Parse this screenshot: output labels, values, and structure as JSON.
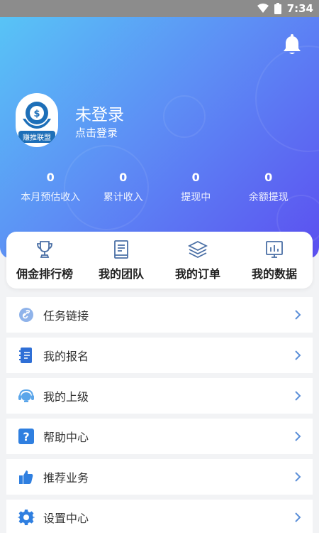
{
  "status_bar": {
    "time": "7:34",
    "wifi_icon": "wifi-icon",
    "battery_icon": "battery-icon"
  },
  "header": {
    "notification_icon": "bell-icon",
    "avatar_logo_text": "赚推联盟",
    "user_name": "未登录",
    "login_hint": "点击登录",
    "colors": {
      "gradient_start": "#58c4f6",
      "gradient_mid": "#5d8ff5",
      "gradient_end": "#5b4ff0"
    }
  },
  "stats": [
    {
      "value": "0",
      "label": "本月预估收入"
    },
    {
      "value": "0",
      "label": "累计收入"
    },
    {
      "value": "0",
      "label": "提现中"
    },
    {
      "value": "0",
      "label": "余额提现"
    }
  ],
  "quick_actions": [
    {
      "icon": "trophy-icon",
      "label": "佣金排行榜"
    },
    {
      "icon": "book-icon",
      "label": "我的团队"
    },
    {
      "icon": "layers-icon",
      "label": "我的订单"
    },
    {
      "icon": "chart-icon",
      "label": "我的数据"
    }
  ],
  "menu": [
    {
      "icon": "link-icon",
      "label": "任务链接",
      "color": "#8fb3ea"
    },
    {
      "icon": "notebook-icon",
      "label": "我的报名",
      "color": "#2f6fd6"
    },
    {
      "icon": "headset-icon",
      "label": "我的上级",
      "color": "#5ba6ea"
    },
    {
      "icon": "help-icon",
      "label": "帮助中心",
      "color": "#2f7fe0"
    },
    {
      "icon": "thumbs-up-icon",
      "label": "推荐业务",
      "color": "#2f7fe0"
    },
    {
      "icon": "gear-icon",
      "label": "设置中心",
      "color": "#2f7fe0"
    }
  ]
}
